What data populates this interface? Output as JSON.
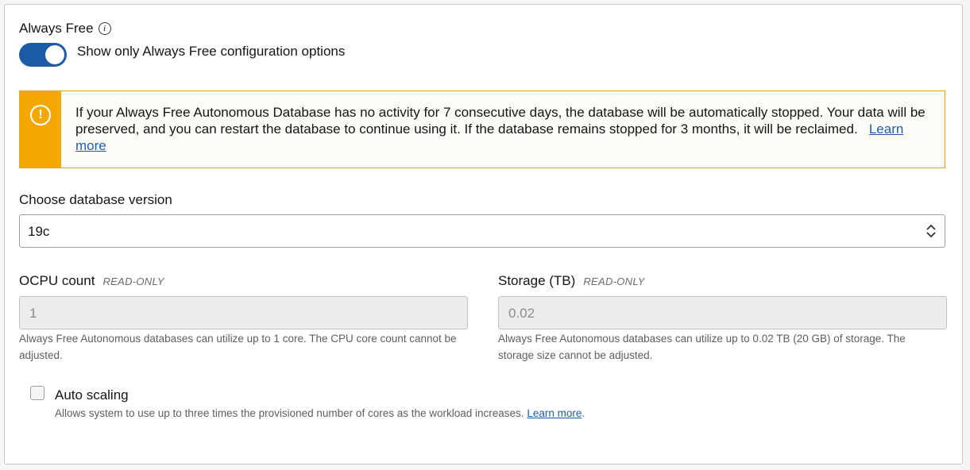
{
  "always_free": {
    "title": "Always Free",
    "info_icon": "i",
    "toggle_on": true,
    "toggle_label": "Show only Always Free configuration options"
  },
  "banner": {
    "icon": "!",
    "message": "If your Always Free Autonomous Database has no activity for 7 consecutive days, the database will be automatically stopped. Your data will be preserved, and you can restart the database to continue using it. If the database remains stopped for 3 months, it will be reclaimed.",
    "link": "Learn more",
    "accent_color": "#f2a800"
  },
  "version": {
    "label": "Choose database version",
    "selected": "19c"
  },
  "ocpu": {
    "label": "OCPU count",
    "tag": "READ-ONLY",
    "value": "1",
    "help": "Always Free Autonomous databases can utilize up to 1 core. The CPU core count cannot be adjusted."
  },
  "storage": {
    "label": "Storage (TB)",
    "tag": "READ-ONLY",
    "value": "0.02",
    "help": "Always Free Autonomous databases can utilize up to 0.02 TB (20 GB) of storage. The storage size cannot be adjusted."
  },
  "auto_scaling": {
    "label": "Auto scaling",
    "checked": false,
    "help": "Allows system to use up to three times the provisioned number of cores as the workload increases.",
    "link": "Learn more",
    "link_suffix": "."
  },
  "colors": {
    "toggle": "#1c5aa6",
    "link": "#1f5fa9"
  }
}
